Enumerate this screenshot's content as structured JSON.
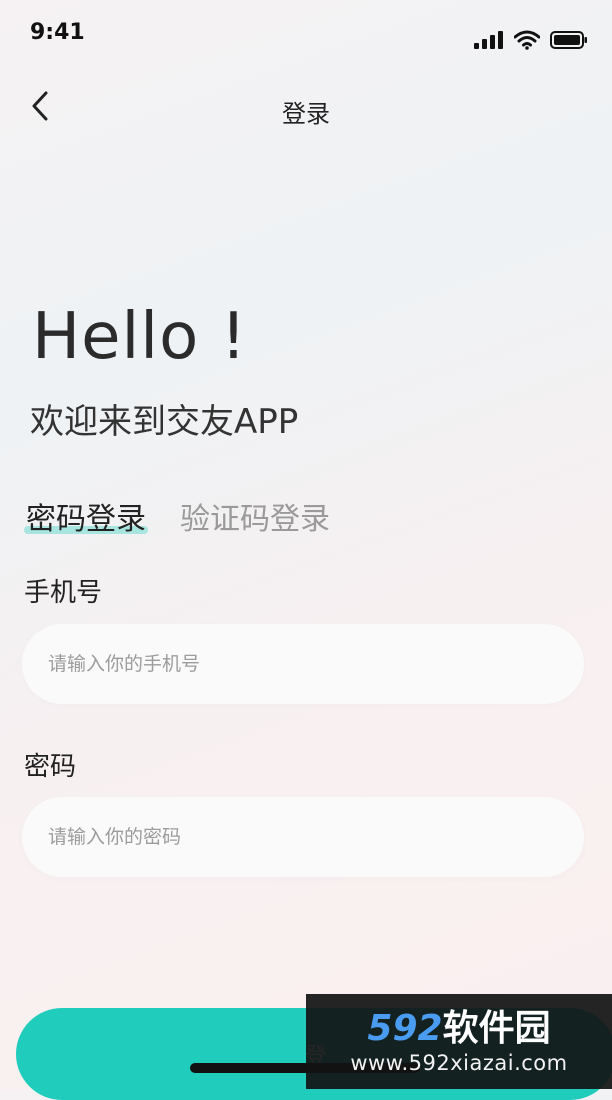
{
  "status_bar": {
    "time": "9:41"
  },
  "nav": {
    "title": "登录"
  },
  "hero": {
    "greeting": "Hello !",
    "subtitle": "欢迎来到交友APP"
  },
  "tabs": [
    {
      "label": "密码登录",
      "active": true
    },
    {
      "label": "验证码登录",
      "active": false
    }
  ],
  "form": {
    "phone_label": "手机号",
    "phone_placeholder": "请输入你的手机号",
    "password_label": "密码",
    "password_placeholder": "请输入你的密码"
  },
  "login_button": {
    "label": "登"
  },
  "watermark": {
    "title_number": "592",
    "title_text": "软件园",
    "url": "www.592xiazai.com"
  },
  "colors": {
    "accent": "#20cdbd",
    "text": "#222222",
    "muted": "#9a9a9a"
  },
  "icons": [
    "signal-icon",
    "wifi-icon",
    "battery-icon",
    "back-chevron-icon"
  ]
}
